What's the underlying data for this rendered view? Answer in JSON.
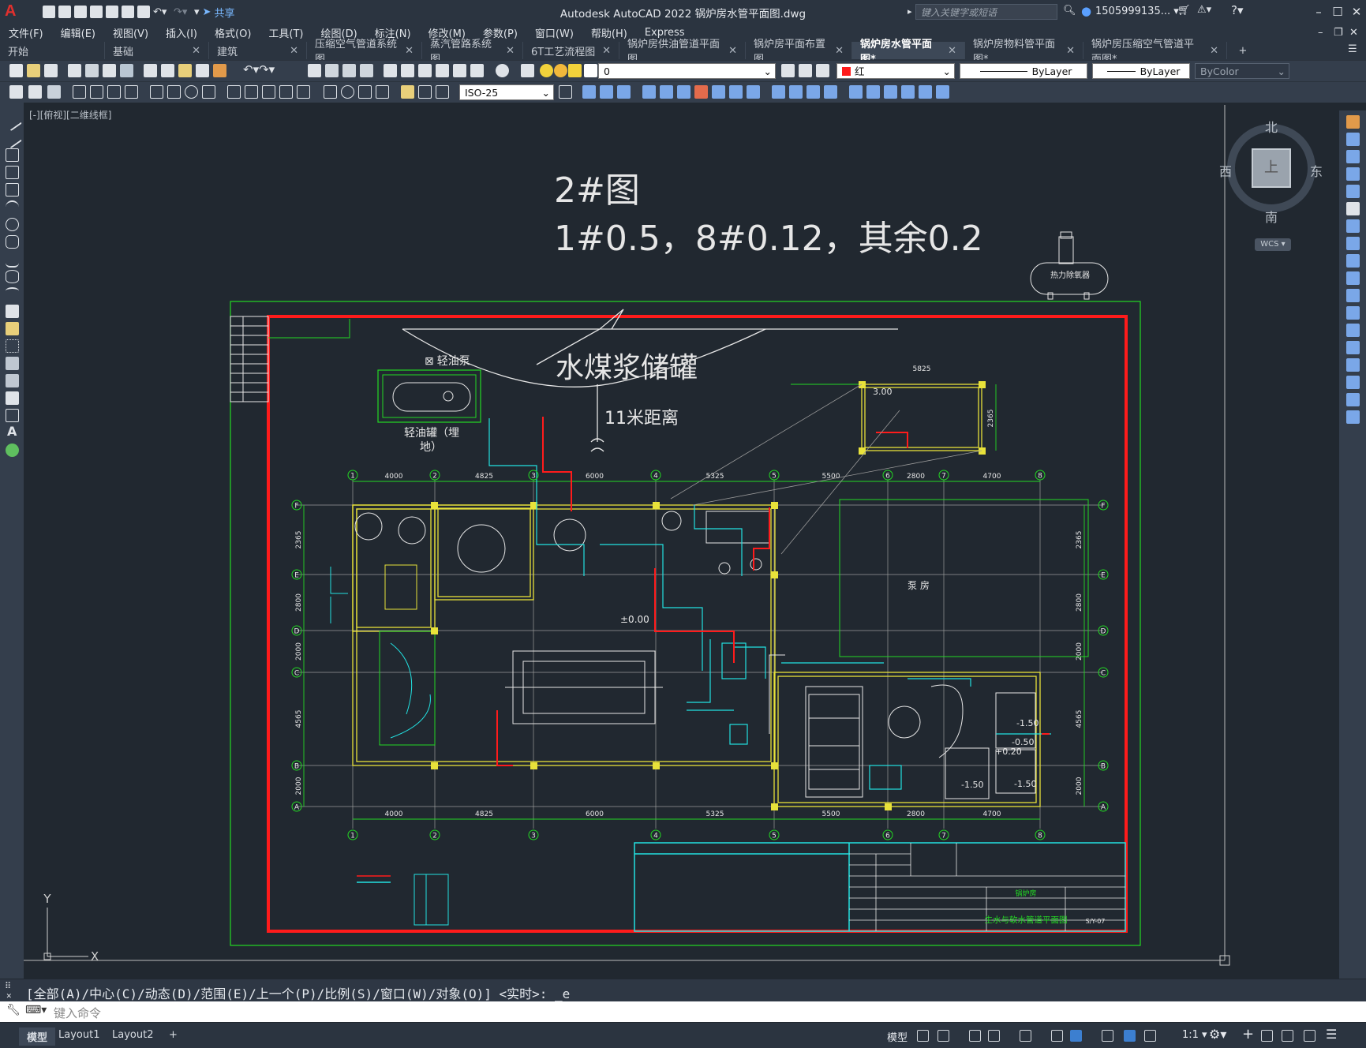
{
  "app": {
    "title": "Autodesk AutoCAD 2022    锅炉房水管平面图.dwg",
    "share_label": "共享",
    "search_placeholder": "键入关键字或短语",
    "user": "1505999135... ▾"
  },
  "menu": [
    "文件(F)",
    "编辑(E)",
    "视图(V)",
    "插入(I)",
    "格式(O)",
    "工具(T)",
    "绘图(D)",
    "标注(N)",
    "修改(M)",
    "参数(P)",
    "窗口(W)",
    "帮助(H)",
    "Express"
  ],
  "tabs": [
    {
      "label": "开始",
      "closable": false,
      "active": false
    },
    {
      "label": "基础",
      "closable": true,
      "active": false
    },
    {
      "label": "建筑",
      "closable": true,
      "active": false
    },
    {
      "label": "压缩空气管道系统图",
      "closable": true,
      "active": false
    },
    {
      "label": "蒸汽管路系统图",
      "closable": true,
      "active": false
    },
    {
      "label": "6T工艺流程图",
      "closable": true,
      "active": false
    },
    {
      "label": "锅炉房供油管道平面图",
      "closable": true,
      "active": false
    },
    {
      "label": "锅炉房平面布置图",
      "closable": true,
      "active": false
    },
    {
      "label": "锅炉房水管平面图*",
      "closable": true,
      "active": true
    },
    {
      "label": "锅炉房物料管平面图*",
      "closable": true,
      "active": false
    },
    {
      "label": "锅炉房压缩空气管道平面图*",
      "closable": true,
      "active": false
    }
  ],
  "toolbar": {
    "layer_value": "0",
    "color_value": "红",
    "linetype_value": "ByLayer",
    "lineweight_value": "ByLayer",
    "plotstyle_value": "ByColor",
    "dimstyle_value": "ISO-25"
  },
  "viewport_label": "[-][俯视][二维线框]",
  "viewcube": {
    "north": "北",
    "south": "南",
    "east": "东",
    "west": "西",
    "face": "上",
    "wcs": "WCS"
  },
  "drawing": {
    "note_title": "2#图",
    "note_text": "1#0.5，8#0.12，其余0.2",
    "tank_label": "水煤浆储罐",
    "distance_label": "11米距离",
    "oil_pump_label": "轻油泵",
    "oil_tank_label_1": "轻油罐（埋",
    "oil_tank_label_2": "地）",
    "deaerator_label": "热力除氧器",
    "room_label": "泵 房",
    "elev_zero": "±0.00",
    "elev_plus": "+0.20",
    "elev_m150a": "-1.50",
    "elev_m050": "-0.50",
    "elev_m150b": "-1.50",
    "elev_m150c": "-1.50",
    "dim_300": "3.00",
    "dim_5825": "5825",
    "dim_2365": "2365",
    "dims_top": [
      "4000",
      "4825",
      "6000",
      "5325",
      "5500",
      "2800",
      "4700"
    ],
    "dims_bottom": [
      "4000",
      "4825",
      "6000",
      "5325",
      "5500",
      "2800",
      "4700"
    ],
    "grid_cols": [
      "1",
      "2",
      "3",
      "4",
      "5",
      "6",
      "7",
      "8"
    ],
    "grid_rows": [
      "F",
      "E",
      "D",
      "C",
      "B",
      "A"
    ],
    "dims_left": [
      "2365",
      "2800",
      "2000",
      "4565",
      "2000"
    ],
    "title_block_name": "生水与软水管道平面图",
    "title_block_no": "S/Y-07",
    "title_block_unit": "锅炉房"
  },
  "command": {
    "history": "[全部(A)/中心(C)/动态(D)/范围(E)/上一个(P)/比例(S)/窗口(W)/对象(O)] <实时>: _e",
    "placeholder": "键入命令"
  },
  "status": {
    "tabs": [
      "模型",
      "Layout1",
      "Layout2"
    ],
    "model_label": "模型",
    "scale": "1:1"
  },
  "colors": {
    "canvas": "#212830",
    "border_red": "#ff1b1b",
    "frame_green": "#23d823",
    "wall_yellow": "#e8e23a",
    "pipe_cyan": "#22e1e1",
    "line_white": "#e6e6e6"
  }
}
